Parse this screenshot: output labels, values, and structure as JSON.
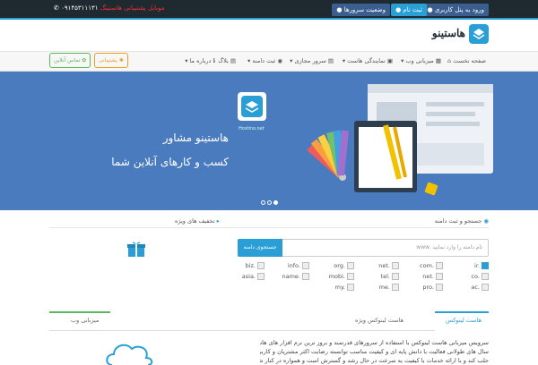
{
  "topbar": {
    "login_label": "ورود به پنل کاربری",
    "register_label": "ثبت نام",
    "server_status_label": "وضعیت سرورها",
    "phone_label": "موبایل پشتیبانی هاستینگ",
    "phone_number": "۰۹۱۴۵۳۱۱۱۳۱",
    "colors": {
      "bg": "#1f2a30",
      "accent": "#2a9fd6",
      "register": "#2a9fd6",
      "status": "#3a5f8f"
    }
  },
  "header": {
    "logo_text": "هاستینو"
  },
  "nav": {
    "items": [
      {
        "label": "صفحه نخست",
        "icon": "home-icon"
      },
      {
        "label": "میزبانی وب",
        "icon": "layers-icon"
      },
      {
        "label": "نمایندگی هاست",
        "icon": "briefcase-icon"
      },
      {
        "label": "سرور مجازی",
        "icon": "server-icon"
      },
      {
        "label": "ثبت دامنه",
        "icon": "globe-icon"
      },
      {
        "label": "بلاگ",
        "icon": "document-icon"
      },
      {
        "label": "درباره ما",
        "icon": "info-icon"
      }
    ],
    "support_button": "پشتیبانی",
    "contact_button": "تماس آنلاین"
  },
  "hero": {
    "logo_sub": "Hostino.net",
    "line1": "هاستینو مشاور",
    "line2": "کسب و کارهای آنلاین شما",
    "active_slide": 1,
    "slide_count": 3
  },
  "domain": {
    "title": "جستجو و ثبت دامنه",
    "placeholder": "نام دامنه را وارد نمایید",
    "www_label": "www.",
    "button": "جستجوی دامنه",
    "tlds_row1": [
      "ir.",
      "com.",
      "net.",
      "org.",
      "info.",
      "biz."
    ],
    "tlds_row2": [
      "co.",
      "net.",
      "tel.",
      "mobi.",
      "name.",
      "asia."
    ],
    "tlds_row3": [
      "ac.",
      "pro.",
      "me.",
      "my.",
      "",
      ""
    ],
    "checked": [
      "ir."
    ]
  },
  "special": {
    "title": "تخفیف های ویژه"
  },
  "tabs": {
    "items": [
      "هاست لینوکس",
      "هاست لینوکس ویژه",
      "میزبانی وب"
    ],
    "active": 0
  },
  "about": {
    "lines": [
      "سرویس میزبانی هاست لینوکس با استفاده از سرورهای قدرتمند و بروز ترین نرم افزار های هاستینگ و میزبانی وب طی",
      "سال های طولانی فعالیت با دانش پایه ای و کیفیت مناسب توانسته رضایت اکثر مشتریان و کاربران هاستینگ هاستینو را",
      "جلب کند و با ارائه خدمات با کیفیت به سرعت در حال رشد و گسترش است و همواره در کنار شماست"
    ]
  }
}
